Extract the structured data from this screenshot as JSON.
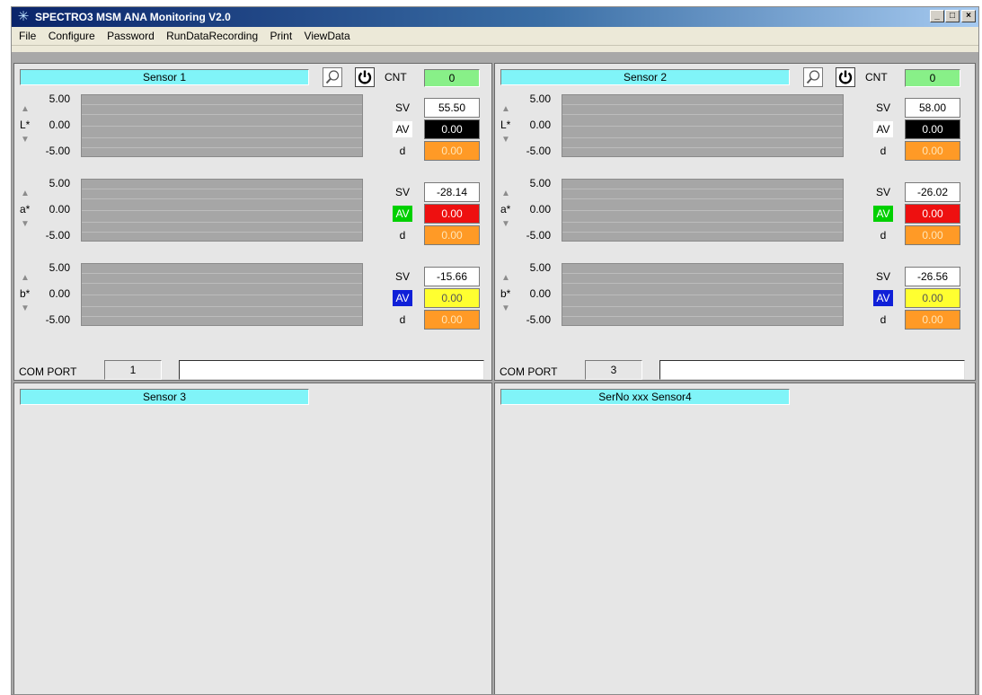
{
  "window": {
    "title": "SPECTRO3 MSM ANA Monitoring V2.0",
    "min_label": "_",
    "max_label": "□",
    "close_label": "×"
  },
  "menu": [
    "File",
    "Configure",
    "Password",
    "RunDataRecording",
    "Print",
    "ViewData"
  ],
  "common": {
    "cnt_label": "CNT",
    "sv_label": "SV",
    "av_label": "AV",
    "d_label": "d",
    "com_port_label": "COM PORT",
    "tick_top": "5.00",
    "tick_mid": "0.00",
    "tick_bot": "-5.00"
  },
  "sensors": [
    {
      "name": "Sensor 1",
      "cnt": "0",
      "com_port": "1",
      "com_message": "",
      "channels": [
        {
          "label": "L*",
          "sv": "55.50",
          "av": "0.00",
          "d": "0.00",
          "av_label_bg": "#ffffff",
          "av_label_fg": "#000000",
          "av_box_bg": "#000000",
          "av_box_fg": "#ffffff"
        },
        {
          "label": "a*",
          "sv": "-28.14",
          "av": "0.00",
          "d": "0.00",
          "av_label_bg": "#00d000",
          "av_label_fg": "#ffffff",
          "av_box_bg": "#ee1010",
          "av_box_fg": "#ffffff"
        },
        {
          "label": "b*",
          "sv": "-15.66",
          "av": "0.00",
          "d": "0.00",
          "av_label_bg": "#1020d8",
          "av_label_fg": "#ffffff",
          "av_box_bg": "#ffff30",
          "av_box_fg": "#555555"
        }
      ]
    },
    {
      "name": "Sensor 2",
      "cnt": "0",
      "com_port": "3",
      "com_message": "",
      "channels": [
        {
          "label": "L*",
          "sv": "58.00",
          "av": "0.00",
          "d": "0.00",
          "av_label_bg": "#ffffff",
          "av_label_fg": "#000000",
          "av_box_bg": "#000000",
          "av_box_fg": "#ffffff"
        },
        {
          "label": "a*",
          "sv": "-26.02",
          "av": "0.00",
          "d": "0.00",
          "av_label_bg": "#00d000",
          "av_label_fg": "#ffffff",
          "av_box_bg": "#ee1010",
          "av_box_fg": "#ffffff"
        },
        {
          "label": "b*",
          "sv": "-26.56",
          "av": "0.00",
          "d": "0.00",
          "av_label_bg": "#1020d8",
          "av_label_fg": "#ffffff",
          "av_box_bg": "#ffff30",
          "av_box_fg": "#555555"
        }
      ]
    },
    {
      "name": "Sensor 3"
    },
    {
      "name": "SerNo xxx Sensor4"
    }
  ],
  "colors": {
    "sensor_name_bg": "#80f4f8",
    "cnt_bg": "#88f088",
    "d_bg": "#ff9a26",
    "plot_bg": "#a6a6a6"
  },
  "icons": {
    "search": "search-icon",
    "power": "power-icon",
    "up_arrow": "arrow-up-icon",
    "down_arrow": "arrow-down-icon"
  }
}
